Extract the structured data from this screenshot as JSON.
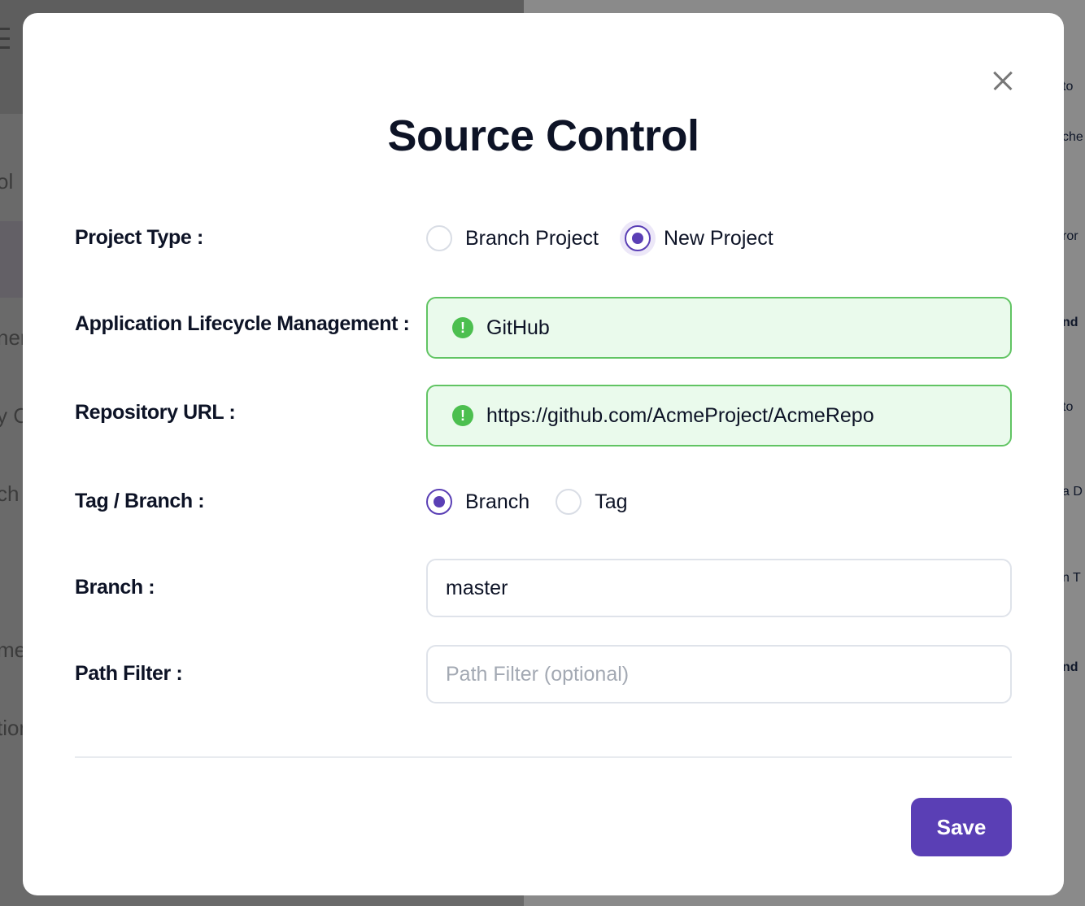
{
  "background": {
    "left_fragments": [
      "ol",
      "ner",
      "y C",
      "ch M",
      "me",
      "tion"
    ],
    "right_fragments": [
      "to",
      "che",
      "ror",
      "nd",
      "to",
      "a D",
      "n T",
      "nd"
    ]
  },
  "modal": {
    "title": "Source Control",
    "close_icon": "close-icon",
    "project_type": {
      "label": "Project Type :",
      "options": [
        {
          "label": "Branch Project",
          "checked": false
        },
        {
          "label": "New Project",
          "checked": true
        }
      ]
    },
    "alm": {
      "label": "Application Lifecycle Management :",
      "value": "GitHub",
      "status_icon": "valid-icon"
    },
    "repository_url": {
      "label": "Repository URL :",
      "value": "https://github.com/AcmeProject/AcmeRepo",
      "status_icon": "valid-icon"
    },
    "tag_branch": {
      "label": "Tag / Branch :",
      "options": [
        {
          "label": "Branch",
          "checked": true
        },
        {
          "label": "Tag",
          "checked": false
        }
      ]
    },
    "branch": {
      "label": "Branch :",
      "value": "master"
    },
    "path_filter": {
      "label": "Path Filter :",
      "value": "",
      "placeholder": "Path Filter (optional)"
    },
    "save_label": "Save"
  },
  "colors": {
    "accent": "#5a3fb5",
    "valid_bg": "#eafaec",
    "valid_border": "#61c463",
    "valid_icon": "#4cbf4f"
  }
}
